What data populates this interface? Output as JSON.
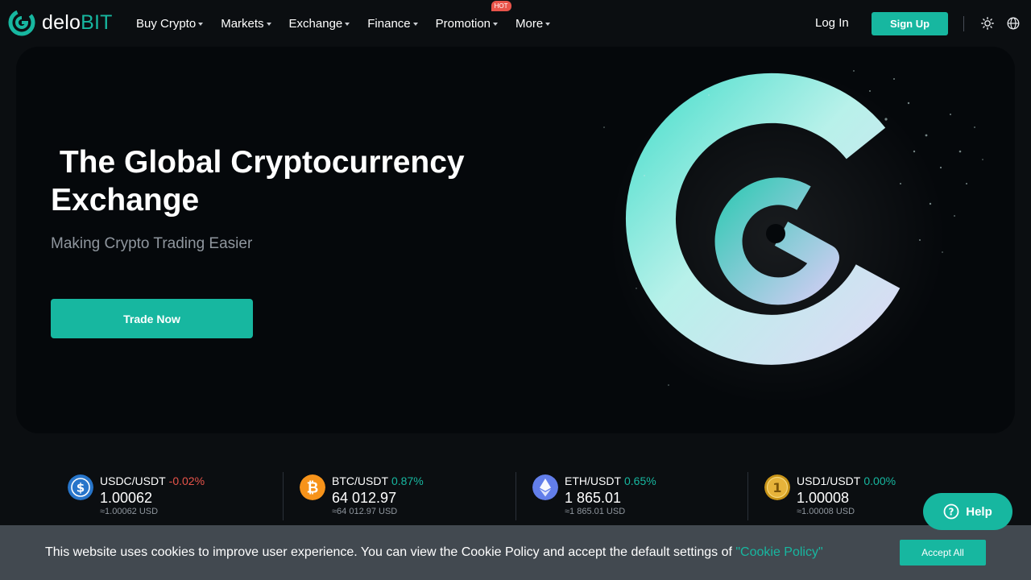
{
  "brand": {
    "name_part1": "delo",
    "name_part2": "BIT",
    "accent": "#17b7a0"
  },
  "nav": {
    "items": [
      {
        "label": "Buy Crypto"
      },
      {
        "label": "Markets"
      },
      {
        "label": "Exchange"
      },
      {
        "label": "Finance"
      },
      {
        "label": "Promotion",
        "badge": "HOT"
      },
      {
        "label": "More"
      }
    ],
    "login_label": "Log In",
    "signup_label": "Sign Up",
    "theme_icon": "sun-icon",
    "language_icon": "globe-icon"
  },
  "hero": {
    "title": " The Global Cryptocurrency\nExchange",
    "subtitle": "Making Crypto Trading Easier",
    "cta_label": "Trade Now"
  },
  "tickers": [
    {
      "pair": "USDC/USDT",
      "change": "-0.02%",
      "direction": "down",
      "price": "1.00062",
      "usd": "≈1.00062 USD",
      "icon": "usdc-icon"
    },
    {
      "pair": "BTC/USDT",
      "change": "0.87%",
      "direction": "up",
      "price": "64 012.97",
      "usd": "≈64 012.97 USD",
      "icon": "btc-icon"
    },
    {
      "pair": "ETH/USDT",
      "change": "0.65%",
      "direction": "up",
      "price": "1 865.01",
      "usd": "≈1 865.01 USD",
      "icon": "eth-icon"
    },
    {
      "pair": "USD1/USDT",
      "change": "0.00%",
      "direction": "up",
      "price": "1.00008",
      "usd": "≈1.00008 USD",
      "icon": "usd1-icon"
    }
  ],
  "help": {
    "label": "Help",
    "icon": "question-icon"
  },
  "cookie": {
    "text": "This website uses cookies to improve user experience. You can view the Cookie Policy and accept the default settings of ",
    "link_label": "\"Cookie Policy\"",
    "accept_label": "Accept All"
  }
}
